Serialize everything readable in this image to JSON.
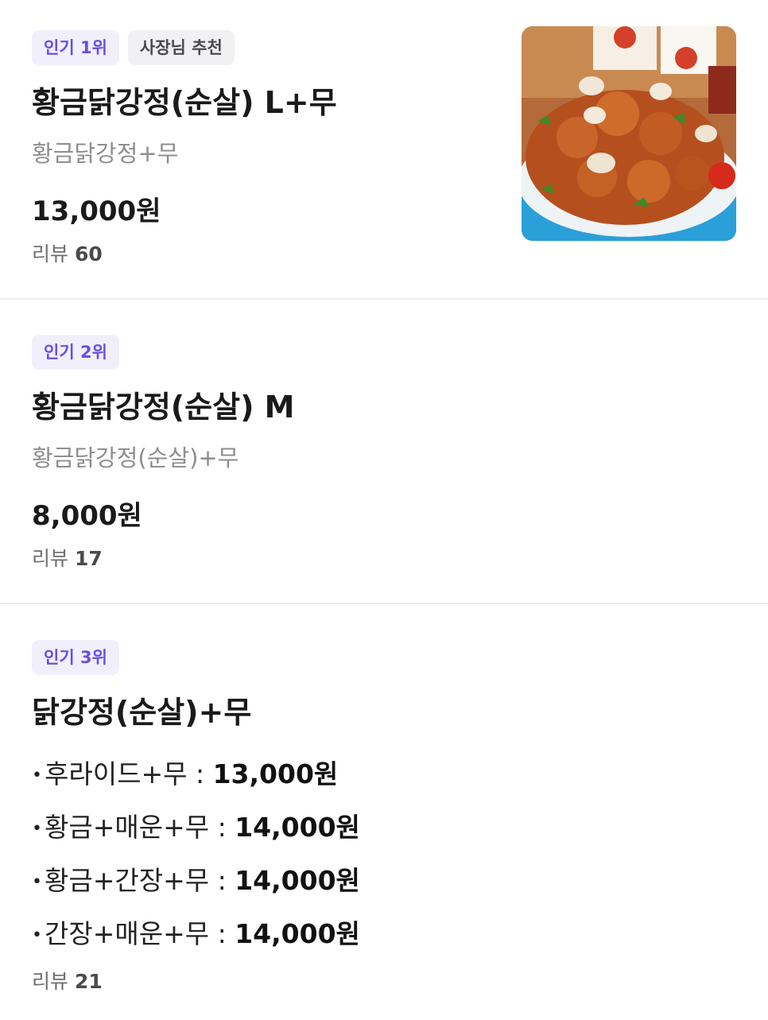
{
  "items": [
    {
      "badges": [
        "인기 1위",
        "사장님 추천"
      ],
      "name": "황금닭강정(순살) L+무",
      "description": "황금닭강정+무",
      "price": "13,000원",
      "review_label": "리뷰",
      "review_count": "60"
    },
    {
      "badges": [
        "인기 2위"
      ],
      "name": "황금닭강정(순살) M",
      "description": "황금닭강정(순살)+무",
      "price": "8,000원",
      "review_label": "리뷰",
      "review_count": "17"
    },
    {
      "badges": [
        "인기 3위"
      ],
      "name": "닭강정(순살)+무",
      "options": [
        {
          "label": "후라이드+무 : ",
          "price": "13,000원"
        },
        {
          "label": "황금+매운+무 : ",
          "price": "14,000원"
        },
        {
          "label": "황금+간장+무 : ",
          "price": "14,000원"
        },
        {
          "label": "간장+매운+무 : ",
          "price": "14,000원"
        }
      ],
      "review_label": "리뷰",
      "review_count": "21"
    }
  ],
  "bullet": "•",
  "colors": {
    "rank_badge_bg": "#f1effc",
    "rank_badge_text": "#6a4fe0",
    "owner_badge_bg": "#f1f1f3",
    "divider": "#ececec"
  }
}
